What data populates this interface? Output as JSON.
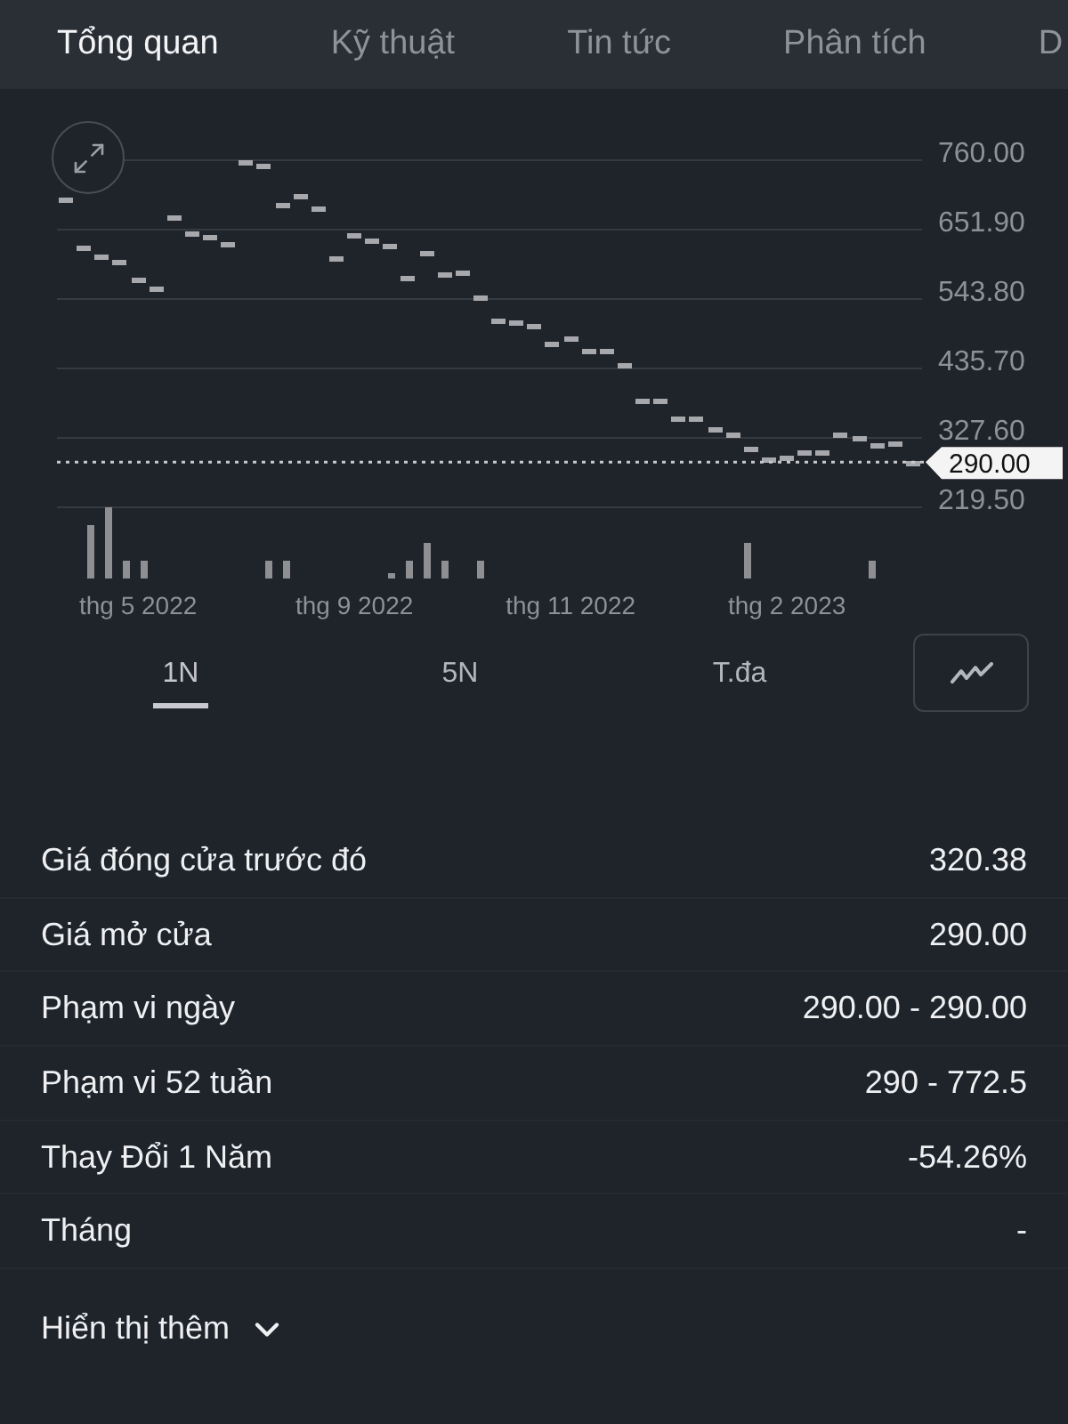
{
  "tabs": [
    {
      "label": "Tổng quan",
      "selected": true
    },
    {
      "label": "Kỹ thuật",
      "selected": false
    },
    {
      "label": "Tin tức",
      "selected": false
    },
    {
      "label": "Phân tích",
      "selected": false
    },
    {
      "label": "D",
      "selected": false
    }
  ],
  "chart": {
    "chart_data": {
      "type": "scatter",
      "categories": [
        null,
        null,
        null,
        null,
        "thg 5 2022",
        null,
        null,
        null,
        null,
        null,
        null,
        null,
        null,
        null,
        null,
        null,
        "thg 9 2022",
        null,
        null,
        null,
        null,
        null,
        null,
        null,
        null,
        null,
        null,
        null,
        "thg 11 2022",
        null,
        null,
        null,
        null,
        null,
        null,
        null,
        null,
        null,
        null,
        null,
        "thg 2 2023",
        null,
        null,
        null,
        null,
        null,
        null,
        null
      ],
      "series": [
        {
          "color": "#a6a8ac",
          "values": [
            699,
            624,
            610,
            602,
            574,
            560,
            671,
            646,
            641,
            630,
            757,
            752,
            691,
            705,
            685,
            608,
            644,
            635,
            627,
            577,
            616,
            583,
            585,
            547,
            511,
            508,
            502,
            475,
            483,
            463,
            463,
            441,
            386,
            386,
            358,
            358,
            342,
            333,
            311,
            294,
            297,
            305,
            305,
            333,
            328,
            317,
            319,
            290
          ]
        }
      ],
      "ylim": [
        219.5,
        760
      ],
      "yticks": [
        {
          "value": 760,
          "label": "760.00"
        },
        {
          "value": 651.9,
          "label": "651.90"
        },
        {
          "value": 543.8,
          "label": "543.80"
        },
        {
          "value": 435.7,
          "label": "435.70"
        },
        {
          "value": 327.6,
          "label": "327.60"
        },
        {
          "value": 219.5,
          "label": "219.50"
        }
      ],
      "grid": true,
      "ref_lines": [
        {
          "axis": "y",
          "value": 290,
          "label": "290.00"
        }
      ]
    }
  },
  "range_tabs": [
    {
      "label": "1N",
      "selected": true
    },
    {
      "label": "5N",
      "selected": false
    },
    {
      "label": "T.đa",
      "selected": false
    }
  ],
  "stats": [
    {
      "label": "Giá đóng cửa trước đó",
      "value": "320.38"
    },
    {
      "label": "Giá mở cửa",
      "value": "290.00"
    },
    {
      "label": "Phạm vi ngày",
      "value": "290.00 - 290.00"
    },
    {
      "label": "Phạm vi 52 tuần",
      "value": "290 - 772.5"
    },
    {
      "label": "Thay Đổi 1 Năm",
      "value": "-54.26%"
    },
    {
      "label": "Tháng",
      "value": "-"
    }
  ],
  "show_more": {
    "label": "Hiển thị thêm",
    "expanded": false
  }
}
